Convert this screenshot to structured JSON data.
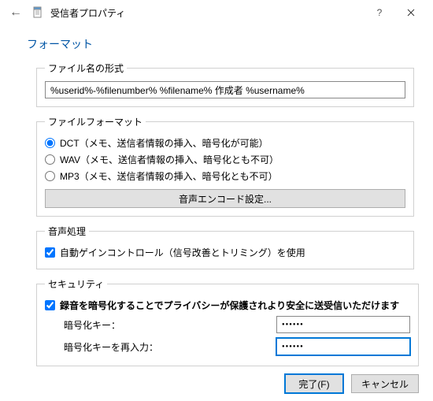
{
  "window": {
    "title": "受信者プロパティ"
  },
  "header": {
    "section": "フォーマット"
  },
  "filename_format": {
    "legend": "ファイル名の形式",
    "value": "%userid%-%filenumber% %filename% 作成者 %username%"
  },
  "file_format": {
    "legend": "ファイルフォーマット",
    "dct": "DCT（メモ、送信者情報の挿入、暗号化が可能）",
    "wav": "WAV（メモ、送信者情報の挿入、暗号化とも不可）",
    "mp3": "MP3（メモ、送信者情報の挿入、暗号化とも不可）",
    "encode_button": "音声エンコード設定..."
  },
  "audio_processing": {
    "legend": "音声処理",
    "agc": "自動ゲインコントロール（信号改善とトリミング）を使用"
  },
  "security": {
    "legend": "セキュリティ",
    "encrypt": "録音を暗号化することでプライバシーが保護されより安全に送受信いただけます",
    "key_label": "暗号化キー：",
    "key_confirm_label": "暗号化キーを再入力：",
    "key_value": "●●●●●●",
    "key_confirm_value": "●●●●●●"
  },
  "footer": {
    "finish": "完了(F)",
    "cancel": "キャンセル"
  }
}
